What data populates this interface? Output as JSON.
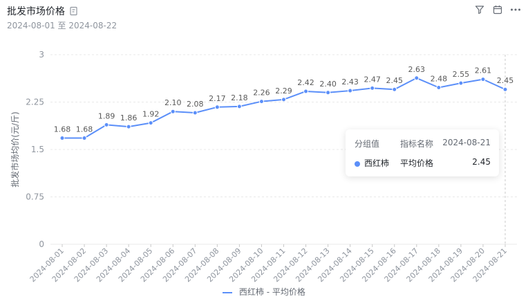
{
  "header": {
    "title": "批发市场价格",
    "subtitle": "2024-08-01 至 2024-08-22",
    "icons": [
      "document-icon",
      "filter-icon",
      "calendar-icon",
      "more-icon"
    ]
  },
  "tooltip": {
    "col_group": "分组值",
    "col_metric": "指标名称",
    "col_date": "2024-08-21",
    "group": "西红柿",
    "metric": "平均价格",
    "value": "2.45"
  },
  "legend": {
    "label": "西红柿 - 平均价格"
  },
  "colors": {
    "series": "#5b8ff9",
    "grid": "#e8e8e8",
    "axis_text": "#8f959e"
  },
  "chart_data": {
    "type": "line",
    "title": "批发市场价格",
    "ylabel": "批发市场均价(元/斤)",
    "xlabel": "",
    "ylim": [
      0,
      3
    ],
    "yticks": [
      "0",
      "0.75",
      "1.5",
      "2.25",
      "3"
    ],
    "grid": true,
    "legend_position": "bottom",
    "categories": [
      "2024-08-01",
      "2024-08-02",
      "2024-08-03",
      "2024-08-04",
      "2024-08-05",
      "2024-08-06",
      "2024-08-07",
      "2024-08-08",
      "2024-08-09",
      "2024-08-10",
      "2024-08-11",
      "2024-08-12",
      "2024-08-13",
      "2024-08-14",
      "2024-08-15",
      "2024-08-16",
      "2024-08-17",
      "2024-08-18",
      "2024-08-19",
      "2024-08-20",
      "2024-08-21"
    ],
    "series": [
      {
        "name": "西红柿 - 平均价格",
        "values": [
          1.68,
          1.68,
          1.89,
          1.86,
          1.92,
          2.1,
          2.08,
          2.17,
          2.18,
          2.26,
          2.29,
          2.42,
          2.4,
          2.43,
          2.47,
          2.45,
          2.63,
          2.48,
          2.55,
          2.61,
          2.45
        ],
        "labels": [
          "1.68",
          "1.68",
          "1.89",
          "1.86",
          "1.92",
          "2.10",
          "2.08",
          "2.17",
          "2.18",
          "2.26",
          "2.29",
          "2.42",
          "2.40",
          "2.43",
          "2.47",
          "2.45",
          "2.63",
          "2.48",
          "2.55",
          "2.61",
          "2.45"
        ]
      }
    ]
  }
}
